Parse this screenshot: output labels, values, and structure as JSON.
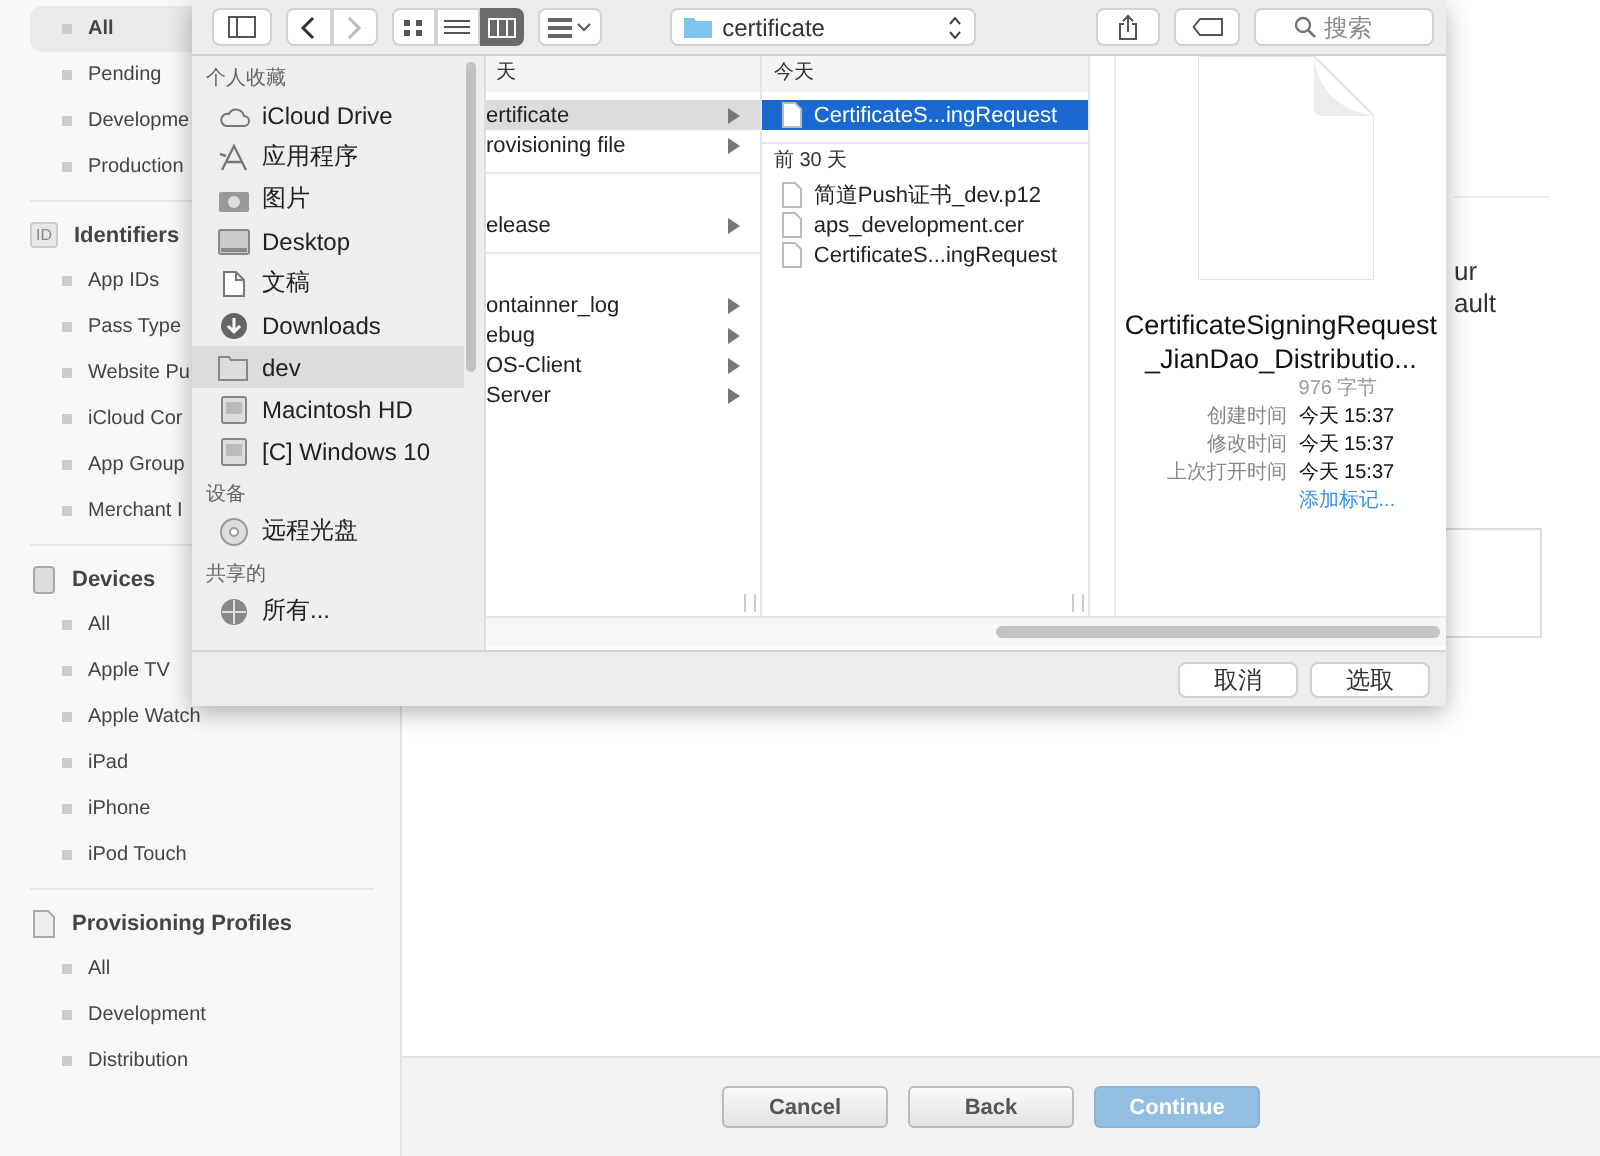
{
  "sidebar": {
    "groups": [
      {
        "items": [
          {
            "label": "All",
            "selected": true
          },
          {
            "label": "Pending",
            "selected": false
          },
          {
            "label": "Developme",
            "selected": false
          },
          {
            "label": "Production",
            "selected": false
          }
        ]
      },
      {
        "kind": "id",
        "badge": "ID",
        "title": "Identifiers",
        "items": [
          {
            "label": "App IDs",
            "selected": false
          },
          {
            "label": "Pass Type",
            "selected": false
          },
          {
            "label": "Website Pu",
            "selected": false
          },
          {
            "label": "iCloud Cor",
            "selected": false
          },
          {
            "label": "App Group",
            "selected": false
          },
          {
            "label": "Merchant I",
            "selected": false
          }
        ]
      },
      {
        "kind": "device",
        "title": "Devices",
        "items": [
          {
            "label": "All",
            "selected": false
          },
          {
            "label": "Apple TV",
            "selected": false
          },
          {
            "label": "Apple Watch",
            "selected": false
          },
          {
            "label": "iPad",
            "selected": false
          },
          {
            "label": "iPhone",
            "selected": false
          },
          {
            "label": "iPod Touch",
            "selected": false
          }
        ]
      },
      {
        "kind": "profile",
        "title": "Provisioning Profiles",
        "items": [
          {
            "label": "All",
            "selected": false
          },
          {
            "label": "Development",
            "selected": false
          },
          {
            "label": "Distribution",
            "selected": false
          }
        ]
      }
    ]
  },
  "content": {
    "lines": [
      "ur",
      "ault"
    ]
  },
  "footer": {
    "buttons": [
      {
        "label": "Cancel",
        "disabled": false
      },
      {
        "label": "Back",
        "disabled": false
      },
      {
        "label": "Continue",
        "disabled": true
      }
    ]
  },
  "dialog": {
    "toolbar": {
      "views": [
        {
          "kind": "icon",
          "selected": false
        },
        {
          "kind": "list",
          "selected": false
        },
        {
          "kind": "column",
          "selected": true
        }
      ],
      "path": "certificate",
      "search": {
        "placeholder": "搜索"
      }
    },
    "sidebar": {
      "sections": [
        {
          "title": "个人收藏",
          "items": [
            {
              "label": "iCloud Drive",
              "kind": "cloud",
              "selected": false
            },
            {
              "label": "应用程序",
              "kind": "apps",
              "selected": false
            },
            {
              "label": "图片",
              "kind": "camera",
              "selected": false
            },
            {
              "label": "Desktop",
              "kind": "desktop",
              "selected": false
            },
            {
              "label": "文稿",
              "kind": "docs",
              "selected": false
            },
            {
              "label": "Downloads",
              "kind": "download",
              "selected": false
            },
            {
              "label": "dev",
              "kind": "folder",
              "selected": true
            },
            {
              "label": "Macintosh HD",
              "kind": "disk",
              "selected": false
            },
            {
              "label": "[C] Windows 10",
              "kind": "disk",
              "selected": false
            }
          ]
        },
        {
          "title": "设备",
          "items": [
            {
              "label": "远程光盘",
              "kind": "disc",
              "selected": false
            }
          ]
        },
        {
          "title": "共享的",
          "items": [
            {
              "label": "所有...",
              "kind": "network",
              "selected": false
            }
          ]
        }
      ]
    },
    "columns": [
      {
        "kind": "folders",
        "groups": [
          {
            "header": "天",
            "rows": [
              {
                "name": "ertificate",
                "selected": true
              },
              {
                "name": "rovisioning file",
                "selected": false
              }
            ]
          },
          {
            "rows": [
              {
                "name": "elease",
                "selected": false
              }
            ]
          },
          {
            "rows": [
              {
                "name": "ontainner_log",
                "selected": false
              },
              {
                "name": "ebug",
                "selected": false
              },
              {
                "name": "OS-Client",
                "selected": false
              },
              {
                "name": "Server",
                "selected": false
              }
            ]
          }
        ]
      },
      {
        "kind": "files",
        "groups": [
          {
            "header": "今天",
            "rows": [
              {
                "name": "CertificateS...ingRequest",
                "selected": true
              }
            ]
          },
          {
            "header": "前 30 天",
            "rows": [
              {
                "name": "简道Push证书_dev.p12",
                "selected": false
              },
              {
                "name": "aps_development.cer",
                "selected": false
              },
              {
                "name": "CertificateS...ingRequest",
                "selected": false
              }
            ]
          }
        ]
      }
    ],
    "preview": {
      "name": "CertificateSigningRequest_JianDao_Distributio...",
      "size": "976 字节",
      "details": [
        {
          "label": "创建时间",
          "value": "今天 15:37"
        },
        {
          "label": "修改时间",
          "value": "今天 15:37"
        },
        {
          "label": "上次打开时间",
          "value": "今天 15:37"
        }
      ],
      "link": "添加标记..."
    },
    "buttons": [
      "取消",
      "选取"
    ]
  }
}
